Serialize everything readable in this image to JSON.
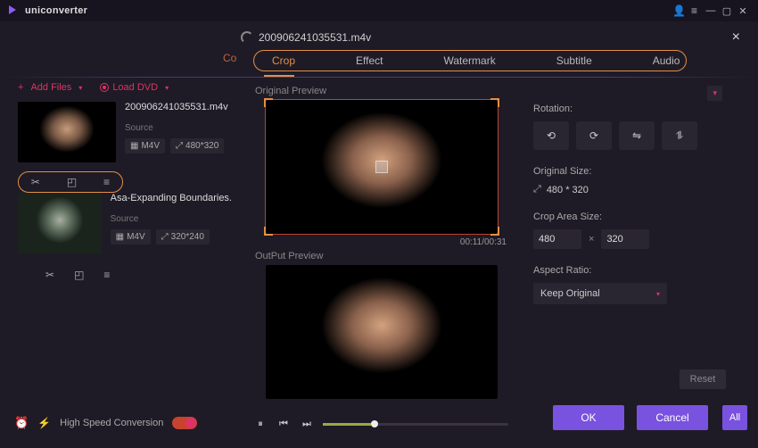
{
  "app": {
    "name": "uniconverter"
  },
  "window": {
    "user_icon": "user",
    "menu_icon": "menu"
  },
  "bg_nav": {
    "tab0": "Co"
  },
  "file": {
    "name": "200906241035531.m4v"
  },
  "editor_tabs": [
    "Crop",
    "Effect",
    "Watermark",
    "Subtitle",
    "Audio"
  ],
  "left": {
    "add_label": "Add Files",
    "dvd_label": "Load DVD",
    "clips": [
      {
        "title": "200906241035531.m4v",
        "source_label": "Source",
        "format": "M4V",
        "dims": "480*320"
      },
      {
        "title": "Asa-Expanding Boundaries.",
        "source_label": "Source",
        "format": "M4V",
        "dims": "320*240"
      }
    ]
  },
  "preview": {
    "original_label": "Original Preview",
    "output_label": "OutPut Preview",
    "time": "00:11/00:31"
  },
  "settings": {
    "rotation_label": "Rotation:",
    "original_size_label": "Original Size:",
    "original_size_value": "480 * 320",
    "crop_area_label": "Crop Area Size:",
    "crop_w": "480",
    "crop_h": "320",
    "aspect_label": "Aspect Ratio:",
    "aspect_value": "Keep Original",
    "reset_label": "Reset"
  },
  "buttons": {
    "ok": "OK",
    "cancel": "Cancel",
    "all": "All"
  },
  "footer": {
    "hs_label": "High Speed Conversion"
  }
}
